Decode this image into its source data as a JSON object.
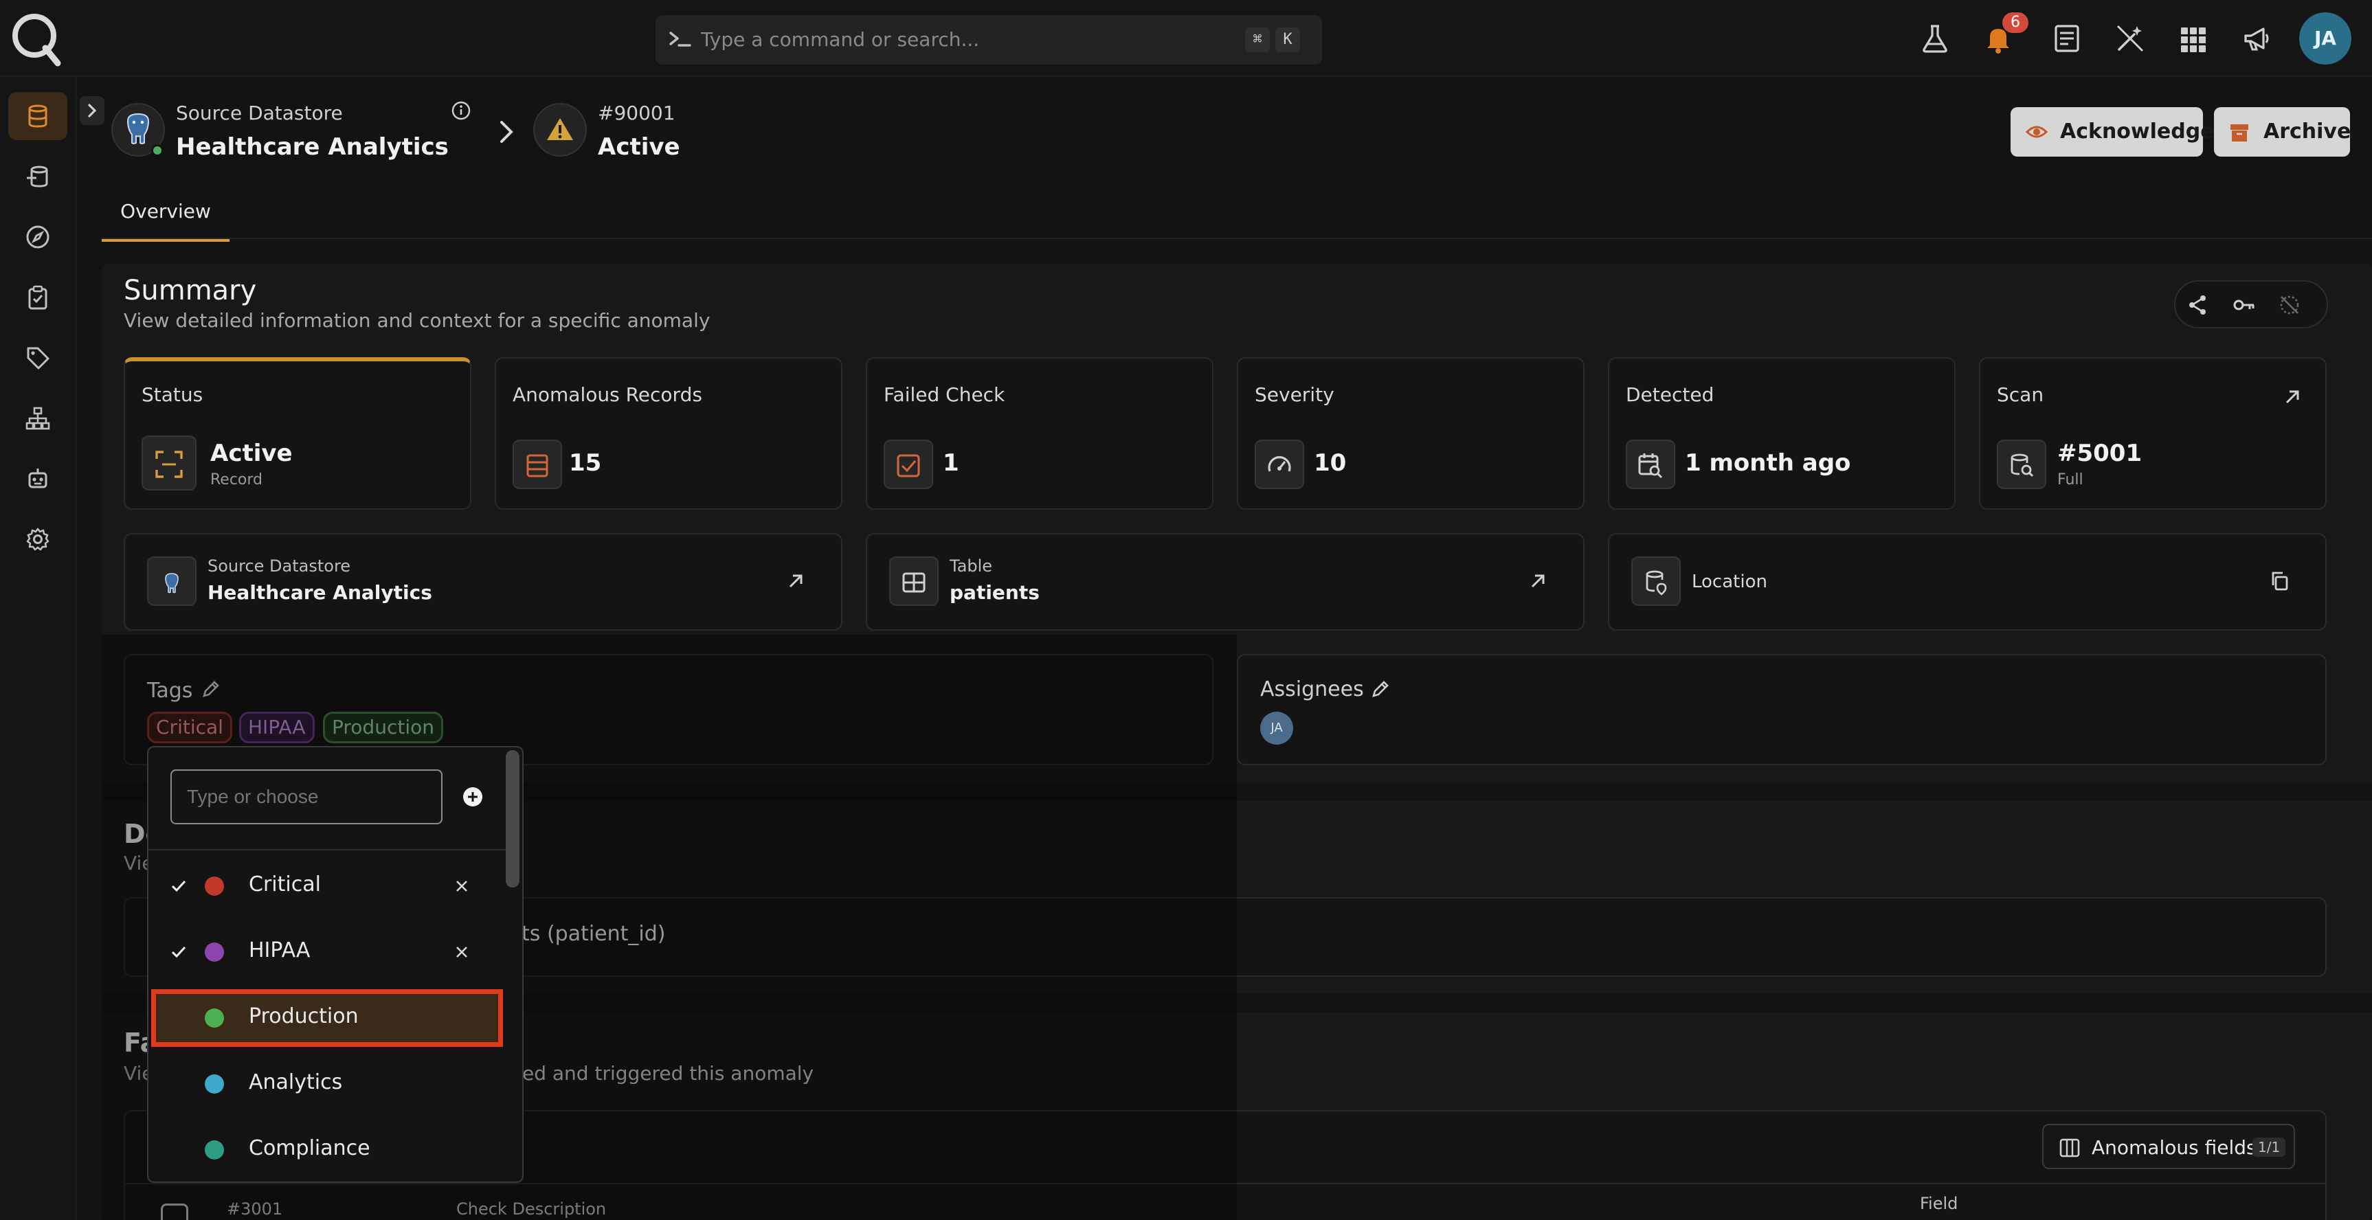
{
  "topbar": {
    "search_placeholder": "Type a command or search...",
    "shortcut_keys": [
      "⌘",
      "K"
    ],
    "notification_count": "6",
    "user_initials": "JA"
  },
  "breadcrumb": {
    "datastore_label": "Source Datastore",
    "datastore_name": "Healthcare Analytics",
    "anomaly_id": "#90001",
    "anomaly_status": "Active"
  },
  "actions": {
    "acknowledge": "Acknowledge",
    "archive": "Archive"
  },
  "tabs": [
    {
      "label": "Overview"
    }
  ],
  "summary": {
    "title": "Summary",
    "subtitle": "View detailed information and context for a specific anomaly",
    "cards": [
      {
        "title": "Status",
        "value": "Active",
        "sub": "Record"
      },
      {
        "title": "Anomalous Records",
        "value": "15"
      },
      {
        "title": "Failed Check",
        "value": "1"
      },
      {
        "title": "Severity",
        "value": "10"
      },
      {
        "title": "Detected",
        "value": "1 month ago"
      },
      {
        "title": "Scan",
        "value": "#5001",
        "sub": "Full"
      }
    ],
    "info": {
      "datastore_label": "Source Datastore",
      "datastore_name": "Healthcare Analytics",
      "table_label": "Table",
      "table_name": "patients",
      "location_label": "Location"
    },
    "tags_label": "Tags",
    "tags": [
      {
        "label": "Critical",
        "color": "#c0392b"
      },
      {
        "label": "HIPAA",
        "color": "#8e44ad"
      },
      {
        "label": "Production",
        "color": "#4caf50"
      }
    ],
    "assignees_label": "Assignees",
    "assignee_initials": "JA"
  },
  "tag_dropdown": {
    "placeholder": "Type or choose",
    "options": [
      {
        "label": "Critical",
        "color": "#c0392b",
        "selected": true
      },
      {
        "label": "HIPAA",
        "color": "#8e44ad",
        "selected": true
      },
      {
        "label": "Production",
        "color": "#4caf50",
        "selected": false
      },
      {
        "label": "Analytics",
        "color": "#3fa9c9",
        "selected": false
      },
      {
        "label": "Compliance",
        "color": "#2f9d83",
        "selected": false
      }
    ]
  },
  "details": {
    "title_partial": "De",
    "subtitle_partial": "Vie",
    "row_text_partial": "nts (patient_id)"
  },
  "failed_checks": {
    "title_partial": "Fa",
    "subtitle_start": "Vie",
    "subtitle_end": "ed and triggered this anomaly",
    "anomalous_fields_label": "Anomalous fields",
    "anomalous_fields_count": "1/1",
    "row_id": "#3001",
    "col_check_description": "Check Description",
    "col_field": "Field"
  }
}
